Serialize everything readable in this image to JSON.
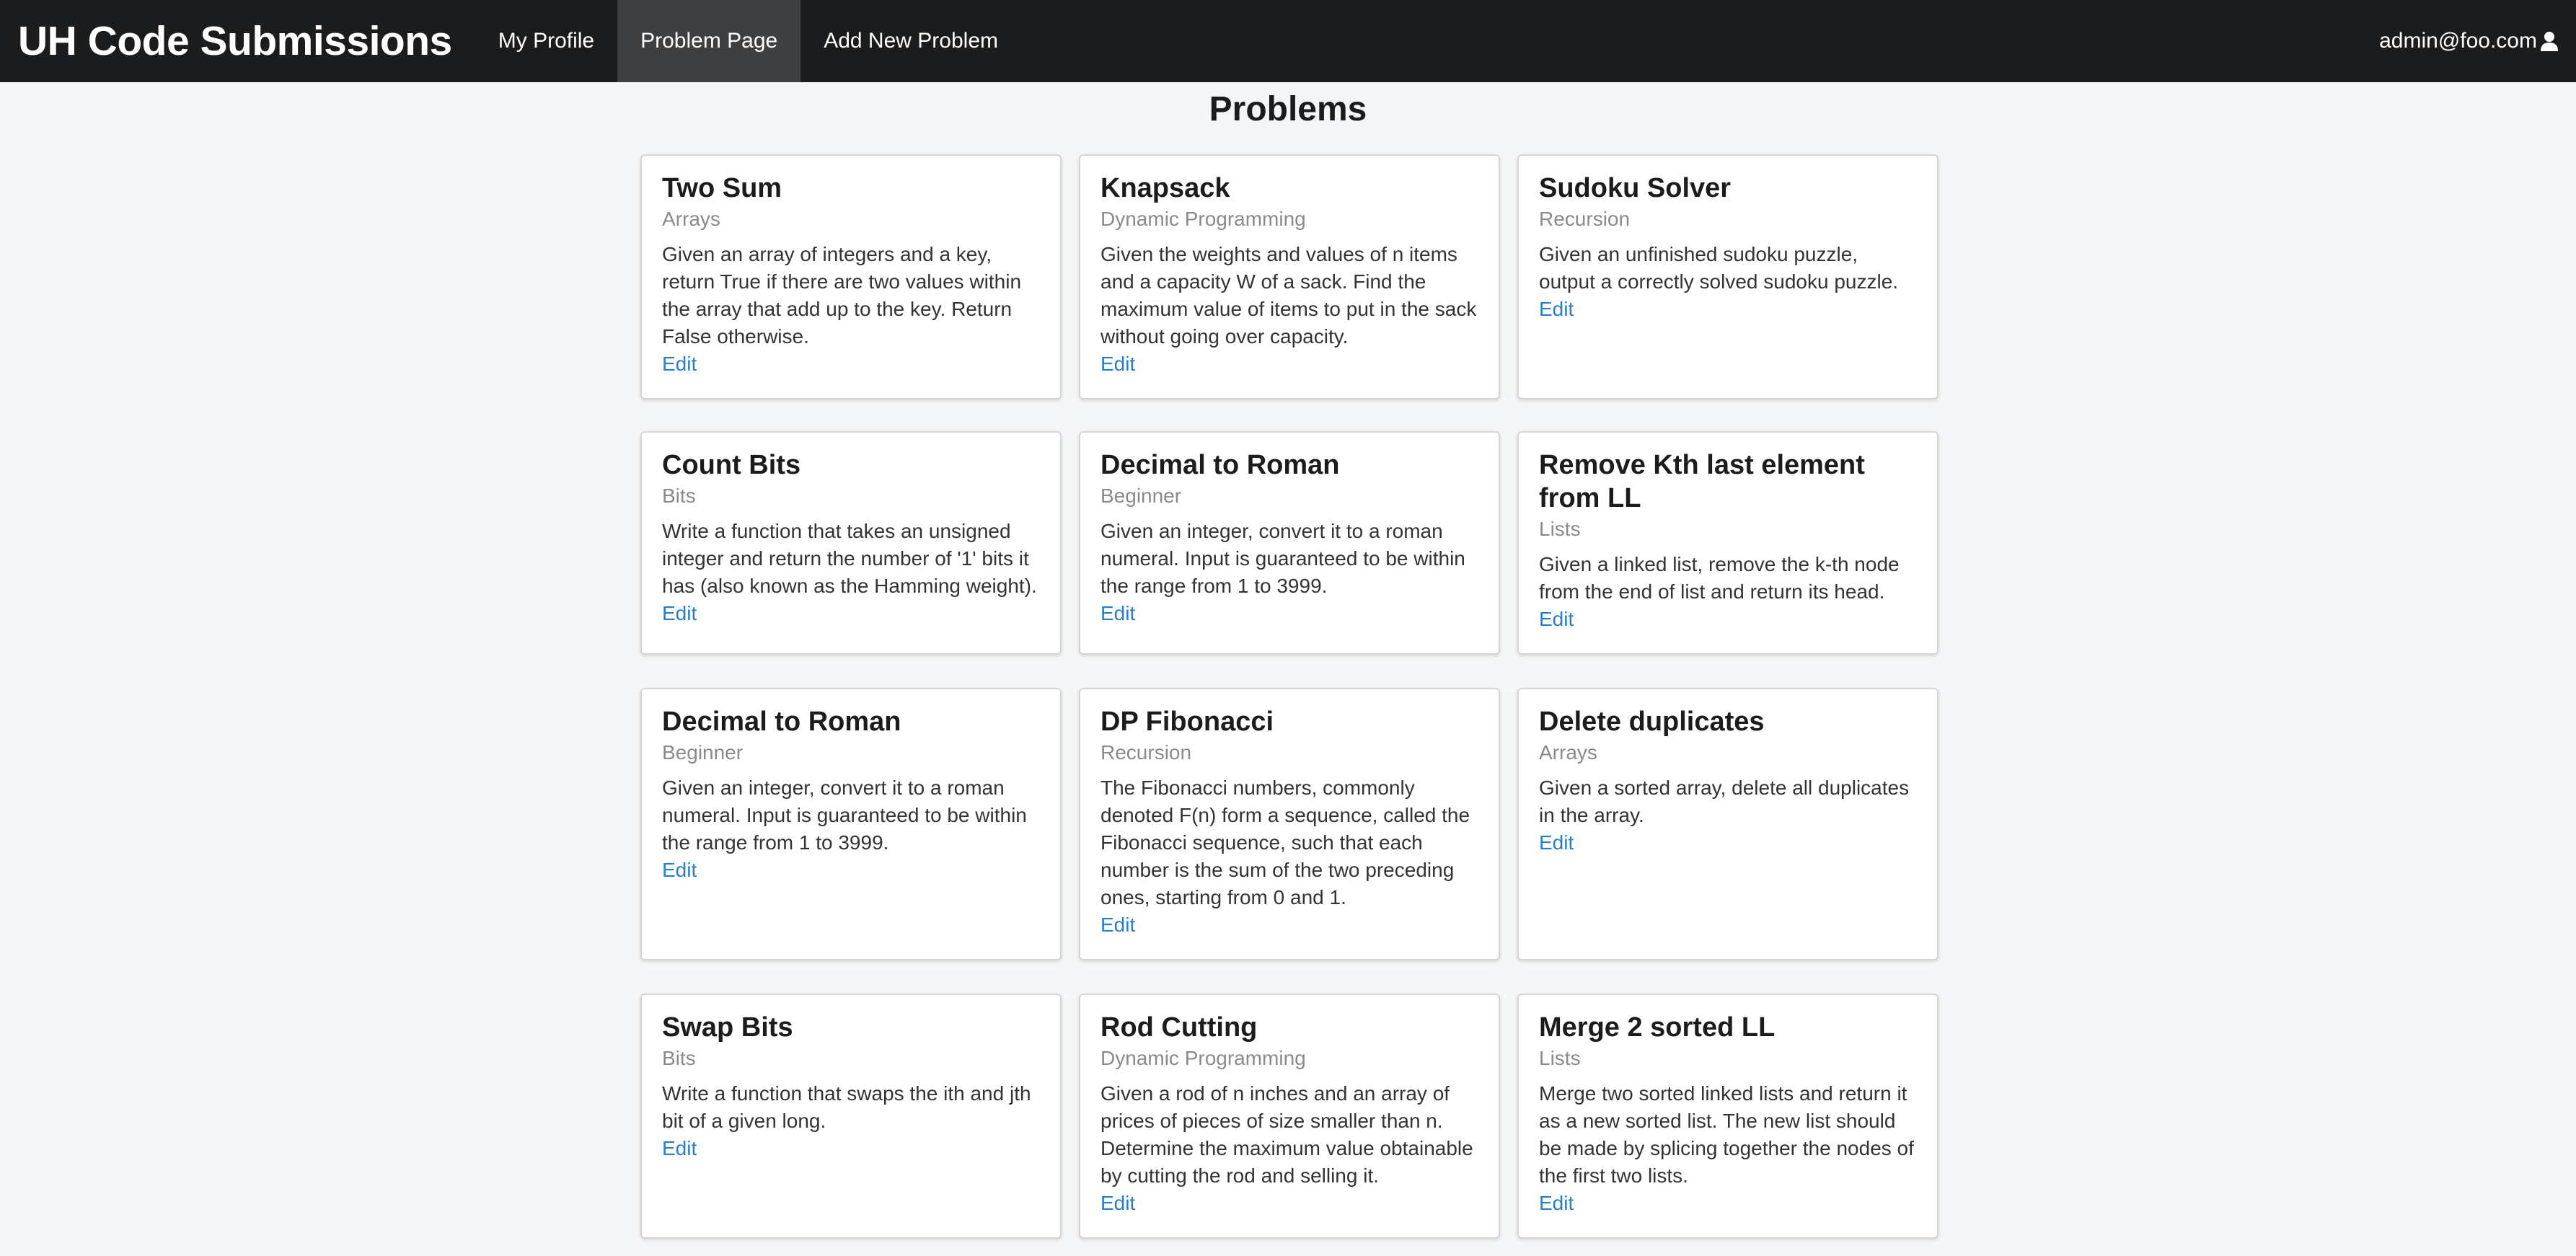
{
  "navbar": {
    "brand": "UH Code Submissions",
    "items": [
      {
        "label": "My Profile"
      },
      {
        "label": "Problem Page",
        "active": true
      },
      {
        "label": "Add New Problem"
      }
    ],
    "user": "admin@foo.com",
    "user_icon": "user-icon"
  },
  "page": {
    "title": "Problems"
  },
  "colors": {
    "navbar_bg": "#1b1c1d",
    "nav_active_bg": "#3e3f41",
    "page_bg": "#f4f5f6",
    "link": "#2a7dc9",
    "meta": "#8a8a8a"
  },
  "problems": [
    {
      "title": "Two Sum",
      "category": "Arrays",
      "description": "Given an array of integers and a key, return True if there are two values within the array that add up to the key. Return False otherwise.",
      "edit_label": "Edit"
    },
    {
      "title": "Knapsack",
      "category": "Dynamic Programming",
      "description": "Given the weights and values of n items and a capacity W of a sack. Find the maximum value of items to put in the sack without going over capacity.",
      "edit_label": "Edit"
    },
    {
      "title": "Sudoku Solver",
      "category": "Recursion",
      "description": "Given an unfinished sudoku puzzle, output a correctly solved sudoku puzzle.",
      "edit_label": "Edit"
    },
    {
      "title": "Count Bits",
      "category": "Bits",
      "description": "Write a function that takes an unsigned integer and return the number of '1' bits it has (also known as the Hamming weight).",
      "edit_label": "Edit"
    },
    {
      "title": "Decimal to Roman",
      "category": "Beginner",
      "description": "Given an integer, convert it to a roman numeral. Input is guaranteed to be within the range from 1 to 3999.",
      "edit_label": "Edit"
    },
    {
      "title": "Remove Kth last element from LL",
      "category": "Lists",
      "description": "Given a linked list, remove the k-th node from the end of list and return its head.",
      "edit_label": "Edit"
    },
    {
      "title": "Decimal to Roman",
      "category": "Beginner",
      "description": "Given an integer, convert it to a roman numeral. Input is guaranteed to be within the range from 1 to 3999.",
      "edit_label": "Edit"
    },
    {
      "title": "DP Fibonacci",
      "category": "Recursion",
      "description": "The Fibonacci numbers, commonly denoted F(n) form a sequence, called the Fibonacci sequence, such that each number is the sum of the two preceding ones, starting from 0 and 1.",
      "edit_label": "Edit"
    },
    {
      "title": "Delete duplicates",
      "category": "Arrays",
      "description": "Given a sorted array, delete all duplicates in the array.",
      "edit_label": "Edit"
    },
    {
      "title": "Swap Bits",
      "category": "Bits",
      "description": "Write a function that swaps the ith and jth bit of a given long.",
      "edit_label": "Edit"
    },
    {
      "title": "Rod Cutting",
      "category": "Dynamic Programming",
      "description": "Given a rod of n inches and an array of prices of pieces of size smaller than n. Determine the maximum value obtainable by cutting the rod and selling it.",
      "edit_label": "Edit"
    },
    {
      "title": "Merge 2 sorted LL",
      "category": "Lists",
      "description": "Merge two sorted linked lists and return it as a new sorted list. The new list should be made by splicing together the nodes of the first two lists.",
      "edit_label": "Edit"
    }
  ]
}
